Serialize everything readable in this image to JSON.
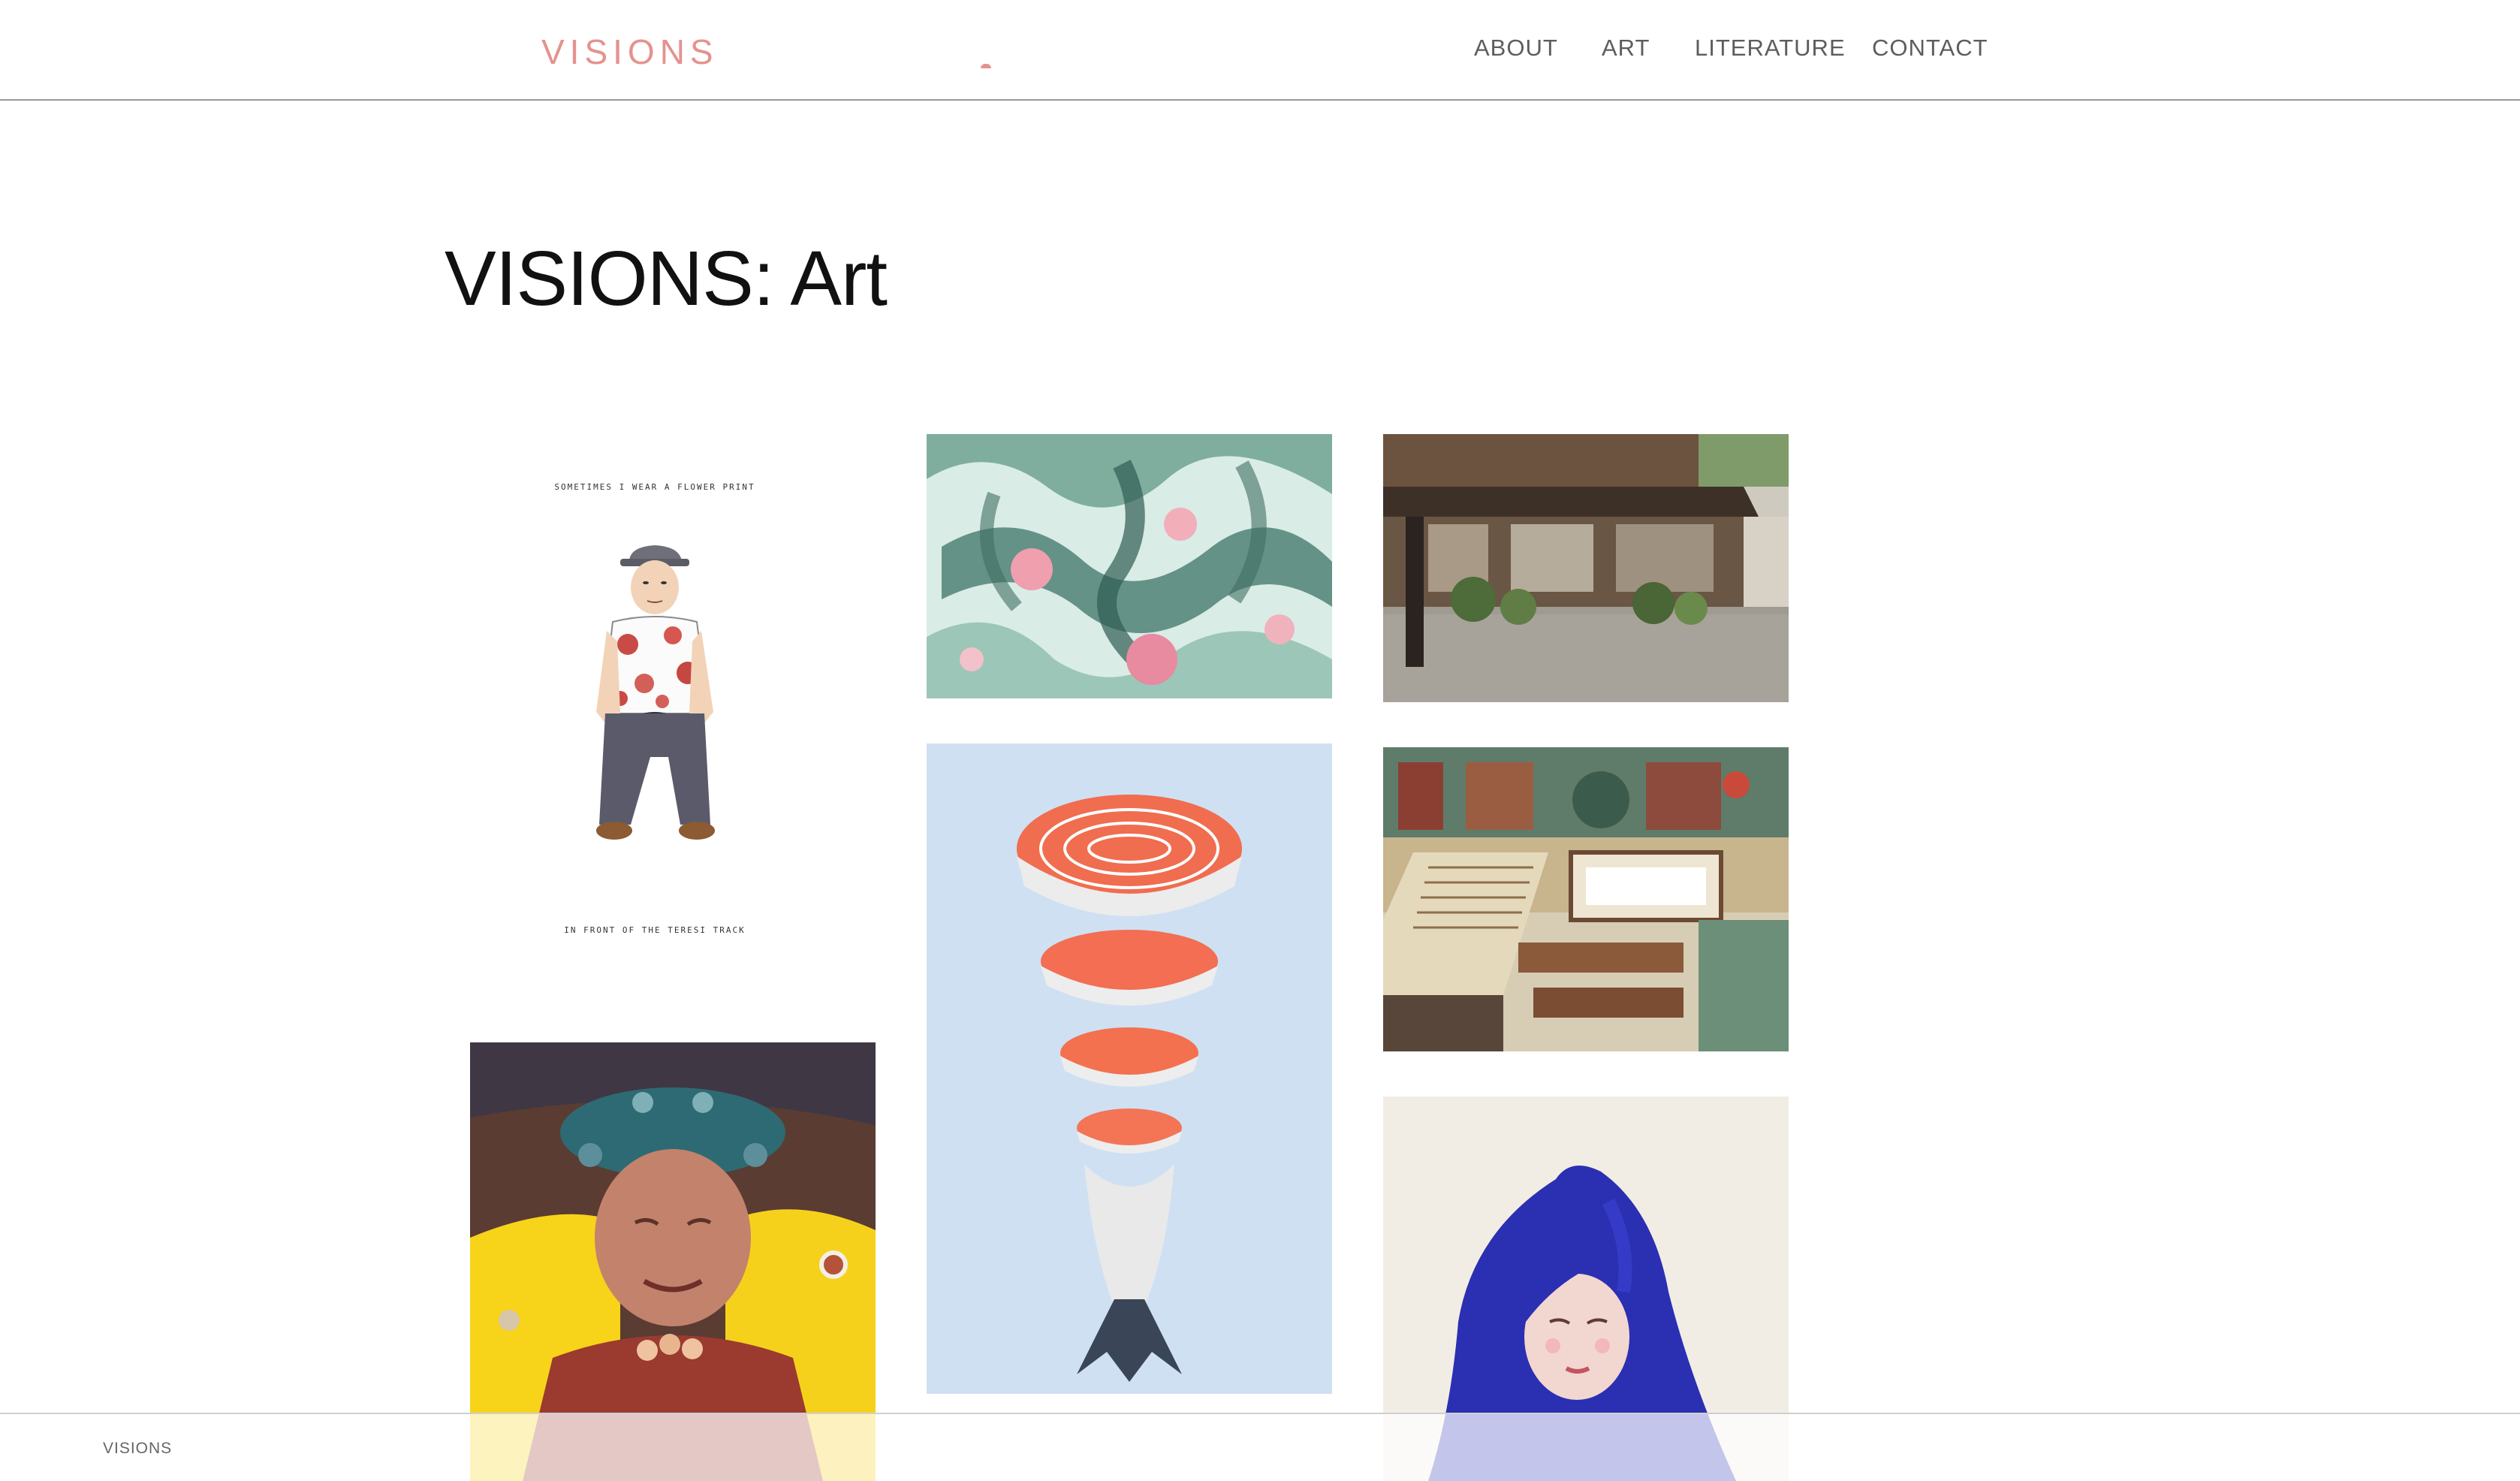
{
  "site": {
    "logo": "VISIONS"
  },
  "nav": {
    "items": [
      {
        "label": "ABOUT"
      },
      {
        "label": "ART"
      },
      {
        "label": "LITERATURE"
      },
      {
        "label": "CONTACT"
      }
    ]
  },
  "page": {
    "title": "VISIONS: Art"
  },
  "gallery": {
    "items": [
      {
        "subject": "illustration of a seated man in a hat and flower-print shirt",
        "caption_top": "SOMETIMES I WEAR A FLOWER PRINT",
        "caption_bottom": "IN FRONT OF THE TERESI TRACK"
      },
      {
        "subject": "green and pink abstract watercolor"
      },
      {
        "subject": "photograph of a traditional wooden house with potted plants"
      },
      {
        "subject": "salmon slices stacked as a spiral running track"
      },
      {
        "subject": "illustrated interior of a library with staircases and lanterns"
      },
      {
        "subject": "painted portrait of an elderly woman in an ornate headdress"
      },
      {
        "subject": "painting of a figure with tall blue hair"
      }
    ]
  },
  "footer": {
    "label": "VISIONS"
  },
  "colors": {
    "accent": "#e5928f",
    "nav_text": "#5d5d5d",
    "title_text": "#111111"
  }
}
